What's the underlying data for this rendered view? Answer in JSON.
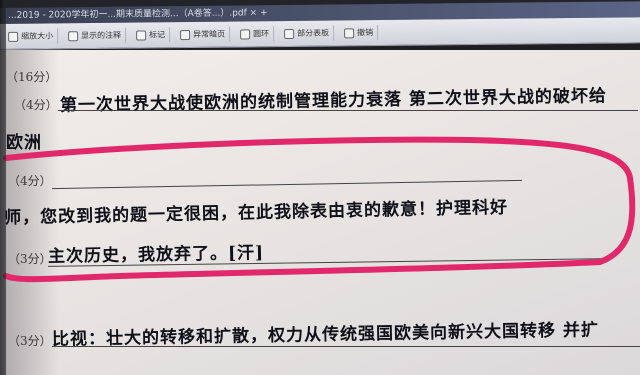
{
  "window": {
    "title": "...2019 - 2020学年初一...期末质量检测...（A卷答...）.pdf  ×  +"
  },
  "toolbar": {
    "buttons": [
      {
        "label": "缩放大小",
        "icon": "zoom-icon"
      },
      {
        "label": "显示的注释",
        "icon": "annotation-icon"
      },
      {
        "label": "标记",
        "icon": "mark-icon"
      },
      {
        "label": "异常暗页",
        "icon": "page-icon"
      },
      {
        "label": "圆环",
        "icon": "ring-icon"
      },
      {
        "label": "部分表板",
        "icon": "panel-icon"
      },
      {
        "label": "撤销",
        "icon": "undo-icon"
      }
    ]
  },
  "paper": {
    "q_total": "（16分）",
    "rows": [
      {
        "score": "（4分）",
        "answer": "第一次世界大战使欧洲的统制管理能力衰落  第二次世界大战的破坏给"
      },
      {
        "score": "",
        "answer": "欧洲"
      },
      {
        "score": "（4分）",
        "answer": ""
      },
      {
        "score": "",
        "answer": "师，您改到我的题一定很困，在此我除表由衷的歉意！护理科好"
      },
      {
        "score": "（3分）",
        "answer": "主次历史，我放弃了。[汗]"
      },
      {
        "score": "（3分）",
        "answer": "比视：壮大的转移和扩散，权力从传统强国欧美向新兴大国转移  并扩"
      }
    ],
    "annotation_color": "#e0286a"
  }
}
